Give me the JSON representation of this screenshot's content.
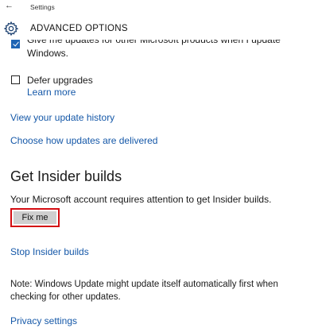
{
  "titlebar": {
    "back_glyph": "←",
    "title": "Settings"
  },
  "header": {
    "icon": "gear-icon",
    "title": "ADVANCED OPTIONS"
  },
  "options": {
    "give_updates": {
      "line1": "Give me updates for other Microsoft products when I update",
      "line2": "Windows.",
      "checked": true
    },
    "defer_upgrades": {
      "label": "Defer upgrades",
      "checked": false,
      "learn_more": "Learn more"
    }
  },
  "links": {
    "update_history": "View your update history",
    "delivery": "Choose how updates are delivered",
    "stop_insider": "Stop Insider builds",
    "privacy": "Privacy settings"
  },
  "insider": {
    "title": "Get Insider builds",
    "message": "Your Microsoft account requires attention to get Insider builds.",
    "fix_button": "Fix me"
  },
  "note": "Note: Windows Update might update itself automatically first when checking for other updates.",
  "colors": {
    "link": "#1558a8",
    "checkbox_accent": "#1e64b4",
    "highlight_box": "#d40d12",
    "button_bg": "#cfcfcf"
  }
}
